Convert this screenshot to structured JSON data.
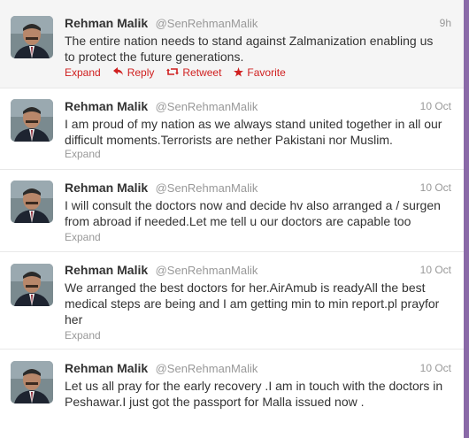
{
  "tweets": [
    {
      "name": "Rehman Malik",
      "handle": "@SenRehmanMalik",
      "time": "9h",
      "text_lines": [
        "The entire nation needs to stand against Zalmanization enabling us",
        "to protect the future generations."
      ],
      "actions": {
        "expand": "Expand",
        "reply": "Reply",
        "retweet": "Retweet",
        "favorite": "Favorite"
      }
    },
    {
      "name": "Rehman Malik",
      "handle": "@SenRehmanMalik",
      "time": "10 Oct",
      "text_lines": [
        "I am proud of my nation as we always stand united together in all our",
        "difficult moments.Terrorists are nether Pakistani nor Muslim."
      ],
      "expand": "Expand"
    },
    {
      "name": "Rehman Malik",
      "handle": "@SenRehmanMalik",
      "time": "10 Oct",
      "text_lines": [
        "I will consult the doctors now and decide hv also arranged a / surgen",
        "from abroad if needed.Let me tell u our doctors are capable too"
      ],
      "expand": "Expand"
    },
    {
      "name": "Rehman Malik",
      "handle": "@SenRehmanMalik",
      "time": "10 Oct",
      "text_lines": [
        "We arranged the best doctors for her.AirAmub is readyAll the best",
        "medical steps are being and I am getting min to min report.pl prayfor",
        "her"
      ],
      "expand": "Expand"
    },
    {
      "name": "Rehman Malik",
      "handle": "@SenRehmanMalik",
      "time": "10 Oct",
      "text_lines": [
        "Let us all pray for the early recovery .I am in touch with the doctors in",
        "Peshawar.I just got the passport for Malla issued now ."
      ]
    }
  ],
  "colors": {
    "action": "#d02020",
    "muted": "#999999",
    "text": "#333333"
  },
  "icons": {
    "reply": "reply-arrow-icon",
    "retweet": "retweet-icon",
    "favorite": "star-icon"
  }
}
